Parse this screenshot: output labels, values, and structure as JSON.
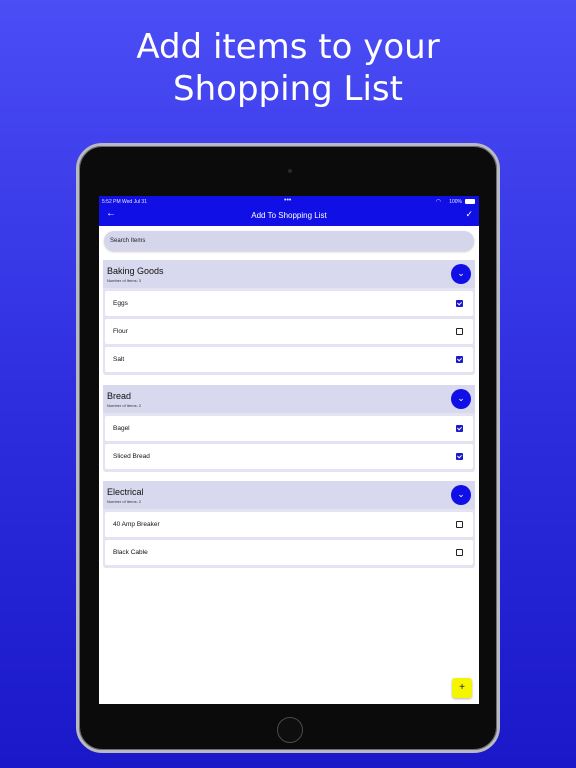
{
  "headline": {
    "line1": "Add items to your",
    "line2": "Shopping List"
  },
  "status_bar": {
    "time": "5:52 PM   Wed Jul 31",
    "dots": "•••",
    "battery": "100%"
  },
  "app_bar": {
    "title": "Add To Shopping List",
    "back_icon": "arrow-left-icon",
    "confirm_icon": "check-icon"
  },
  "search": {
    "placeholder": "Search Items"
  },
  "categories": [
    {
      "name": "Baking Goods",
      "count_label": "Number of Items: 3",
      "items": [
        {
          "label": "Eggs",
          "checked": true
        },
        {
          "label": "Flour",
          "checked": false
        },
        {
          "label": "Salt",
          "checked": true
        }
      ]
    },
    {
      "name": "Bread",
      "count_label": "Number of Items: 2",
      "items": [
        {
          "label": "Bagel",
          "checked": true
        },
        {
          "label": "Sliced Bread",
          "checked": true
        }
      ]
    },
    {
      "name": "Electrical",
      "count_label": "Number of Items: 2",
      "items": [
        {
          "label": "40 Amp Breaker",
          "checked": false
        },
        {
          "label": "Black Cable",
          "checked": false
        }
      ]
    }
  ],
  "fab": {
    "label": "+"
  },
  "colors": {
    "accent": "#1010e6",
    "fab": "#f5f500",
    "category_bg": "#d8d8ee"
  }
}
